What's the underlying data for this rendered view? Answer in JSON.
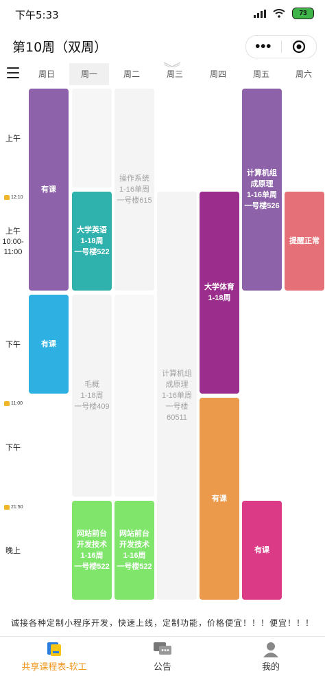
{
  "status_bar": {
    "time": "下午5:33",
    "battery": "73"
  },
  "header": {
    "title": "第10周（双周）",
    "more_label": "•••"
  },
  "weekdays": [
    "周日",
    "周一",
    "周二",
    "周三",
    "周四",
    "周五",
    "周六"
  ],
  "time_labels": {
    "morning": "上午",
    "mark1": "12:10",
    "morning2": [
      "上午",
      "10:00-",
      "11:00"
    ],
    "afternoon": "下午",
    "mark2": "11:00",
    "afternoon2": "下午",
    "mark3": "21:50",
    "evening": "晚上"
  },
  "courses": {
    "sun1": {
      "name": "有课"
    },
    "sun2": {
      "name": "有课"
    },
    "mon1": {
      "name": "大学英语",
      "weeks": "1-18周",
      "room": "一号楼522"
    },
    "mon2": {
      "name": "毛概",
      "weeks": "1-18周",
      "room": "一号楼409"
    },
    "mon3": {
      "name": "网站前台开发技术",
      "weeks": "1-16周",
      "room": "一号楼522"
    },
    "tue1": {
      "name": "操作系统",
      "weeks": "1-16单周",
      "room": "一号楼615"
    },
    "tue2": {
      "name": "网站前台开发技术",
      "weeks": "1-16周",
      "room": "一号楼522"
    },
    "wed1": {
      "name": "计算机组成原理",
      "weeks": "1-16单周",
      "room": "一号楼60511"
    },
    "thu1": {
      "name": "大学体育",
      "weeks": "1-18周"
    },
    "thu2": {
      "name": "有课"
    },
    "fri1": {
      "name": "计算机组成原理",
      "weeks": "1-16单周",
      "room": "一号楼526"
    },
    "fri2": {
      "name": "有课"
    },
    "sat1": {
      "name": "提醒正常"
    }
  },
  "ad_text": "诚接各种定制小程序开发，快速上线，定制功能，价格便宜！！！便宜！！！",
  "tabbar": [
    {
      "label": "共享课程表-软工",
      "icon": "book-app-icon"
    },
    {
      "label": "公告",
      "icon": "chat-icon"
    },
    {
      "label": "我的",
      "icon": "user-icon"
    }
  ],
  "colors": {
    "purple": "#8e62aa",
    "teal": "#2fb1ad",
    "blue": "#2eb0e3",
    "magenta": "#9b2d8c",
    "orange": "#ea9a4a",
    "violet": "#8d62a8",
    "coral": "#e67078",
    "pink": "#da3a86",
    "green": "#7fe66b",
    "ghost": "#f4f4f4",
    "accent": "#f0961c"
  }
}
